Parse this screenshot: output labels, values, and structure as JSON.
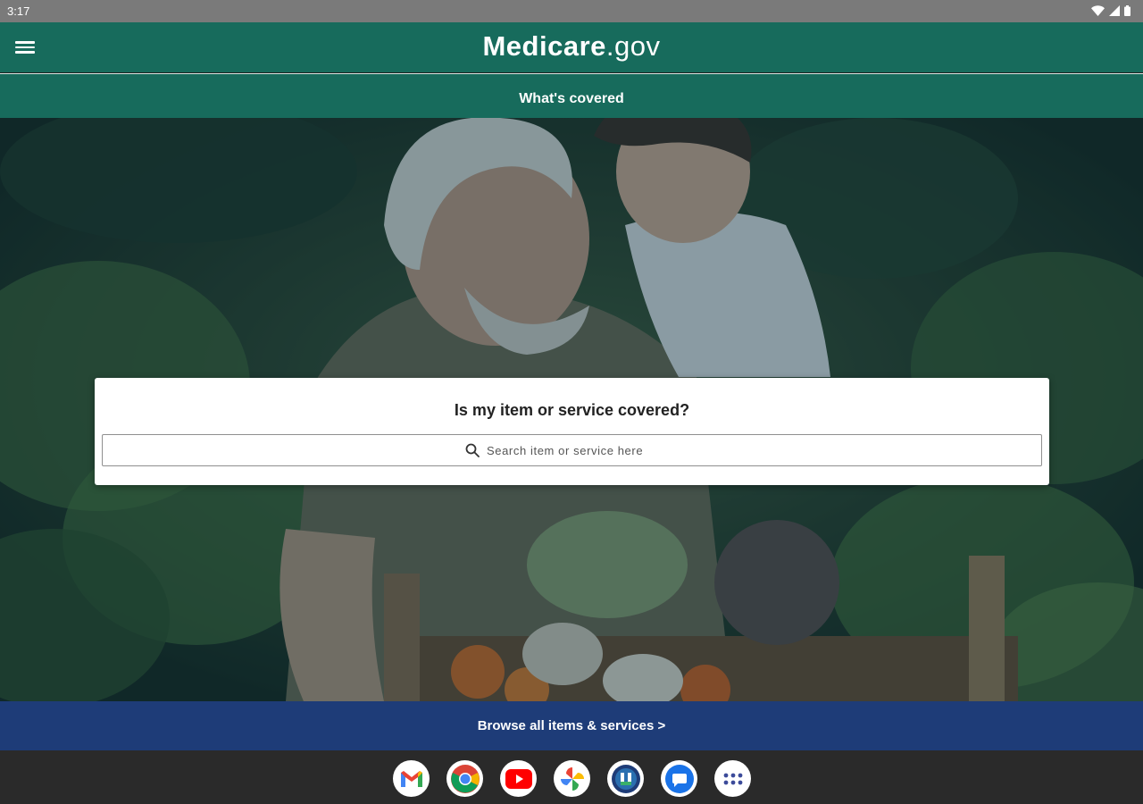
{
  "status_bar": {
    "time": "3:17",
    "icons": [
      "wifi-icon",
      "signal-icon",
      "battery-icon"
    ]
  },
  "header": {
    "logo_primary": "Medicare",
    "logo_secondary": ".gov",
    "menu_icon": "hamburger-menu-icon"
  },
  "subnav": {
    "title": "What's covered"
  },
  "search_card": {
    "title": "Is my item or service covered?",
    "placeholder": "Search item or service here",
    "icon": "search-icon"
  },
  "browse": {
    "label": "Browse all items & services >"
  },
  "dock": {
    "apps": [
      "gmail-icon",
      "chrome-icon",
      "youtube-icon",
      "photos-icon",
      "medicare-app-icon",
      "messages-icon",
      "app-drawer-icon"
    ]
  },
  "colors": {
    "header_green": "#176b5c",
    "browse_blue": "#1e3c78",
    "status_gray": "#7a7a7a",
    "dock_dark": "#2a2a2a"
  }
}
